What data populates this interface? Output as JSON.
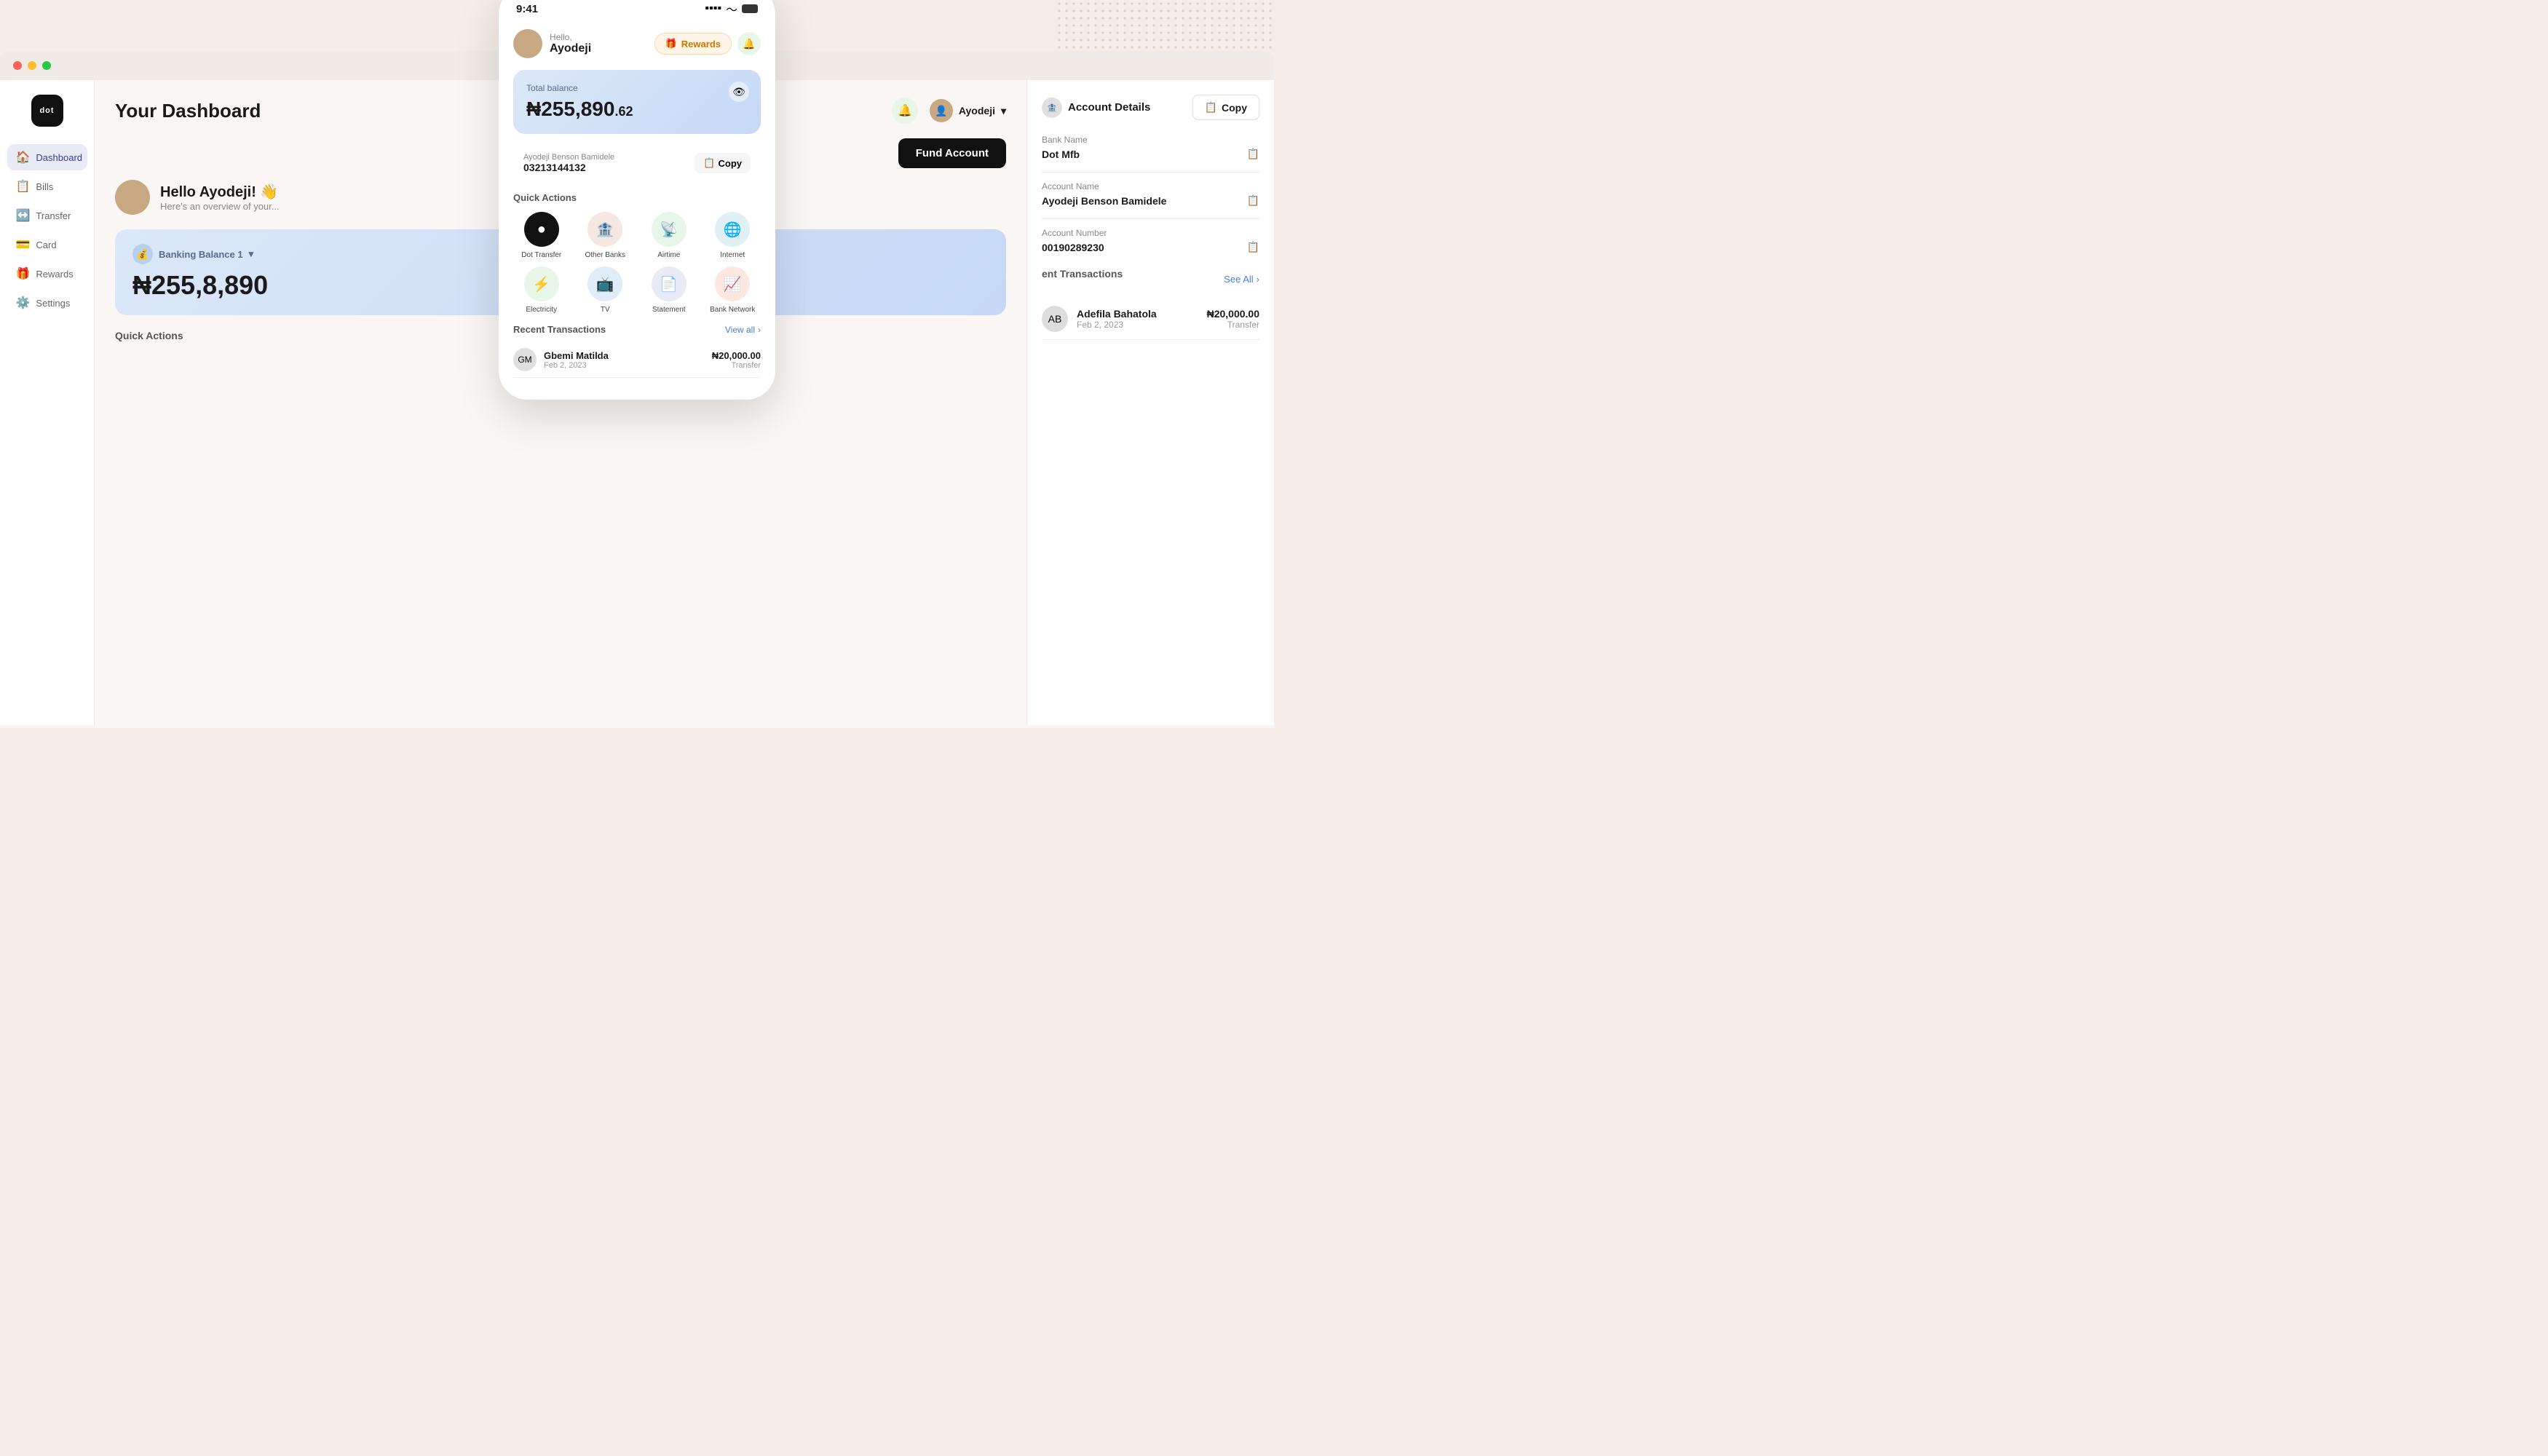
{
  "app": {
    "title": "Your Dashboard"
  },
  "mac": {
    "dots": [
      "red",
      "yellow",
      "green"
    ]
  },
  "sidebar": {
    "logo_text": "dot",
    "items": [
      {
        "id": "dashboard",
        "label": "Dashboard",
        "icon": "🏠",
        "active": true
      },
      {
        "id": "bills",
        "label": "Bills",
        "icon": "📋"
      },
      {
        "id": "transfer",
        "label": "Transfer",
        "icon": "↔️"
      },
      {
        "id": "card",
        "label": "Card",
        "icon": "💳"
      },
      {
        "id": "rewards",
        "label": "Rewards",
        "icon": "🎁"
      },
      {
        "id": "settings",
        "label": "Settings",
        "icon": "⚙️"
      }
    ]
  },
  "header": {
    "title": "Your Dashboard",
    "notification_icon": "🔔",
    "user_name": "Ayodeji",
    "fund_account_label": "Fund Account"
  },
  "greeting": {
    "hello": "Hello Ayodeji! 👋",
    "subtitle": "Here's an overview of your..."
  },
  "banking_balance": {
    "label": "Banking Balance 1",
    "amount": "₦255,8",
    "amount_full": "₦255,890"
  },
  "quick_actions_label": "Quick Actions",
  "account_details": {
    "title": "Account Details",
    "copy_label": "Copy",
    "bank_name_label": "Bank Name",
    "bank_name": "Dot Mfb",
    "account_name_label": "Account Name",
    "account_name": "Ayodeji Benson Bamidele",
    "account_number_label": "Account Number",
    "account_number": "00190289230"
  },
  "recent_transactions_right": {
    "title": "ent Transactions",
    "see_all_label": "See All"
  },
  "phone": {
    "status_bar": {
      "time": "9:41",
      "signal": "📶",
      "wifi": "📡",
      "battery": "🔋"
    },
    "greeting": {
      "hello": "Hello,",
      "name": "Ayodeji"
    },
    "rewards_label": "Rewards",
    "balance": {
      "label": "Total balance",
      "main": "₦255,890",
      "cents": ".62"
    },
    "account": {
      "name": "Ayodeji Benson Bamidele",
      "number": "03213144132",
      "copy_label": "Copy"
    },
    "quick_actions": {
      "label": "Quick Actions",
      "items": [
        {
          "id": "dot-transfer",
          "label": "Dot Transfer",
          "icon": "⚫",
          "bg": "#111"
        },
        {
          "id": "other-banks",
          "label": "Other Banks",
          "icon": "🏦",
          "bg": "#f5e8e0"
        },
        {
          "id": "airtime",
          "label": "Airtime",
          "icon": "📡",
          "bg": "#e8f5e9"
        },
        {
          "id": "internet",
          "label": "Internet",
          "icon": "🌐",
          "bg": "#e0f0f5"
        },
        {
          "id": "electricity",
          "label": "Electricity",
          "icon": "⚡",
          "bg": "#e8f5e9"
        },
        {
          "id": "tv",
          "label": "TV",
          "icon": "📺",
          "bg": "#e0ecf8"
        },
        {
          "id": "statement",
          "label": "Statement",
          "icon": "📄",
          "bg": "#e8eaf6"
        },
        {
          "id": "bank-network",
          "label": "Bank Network",
          "icon": "📈",
          "bg": "#fce8e0"
        }
      ]
    },
    "recent_transactions": {
      "label": "Recent Transactions",
      "view_all": "View all",
      "items": [
        {
          "name": "Gbemi Matilda",
          "date": "Feb 2, 2023",
          "amount": "₦20,000.00",
          "type": "Transfer",
          "avatar": "GM"
        }
      ]
    }
  }
}
